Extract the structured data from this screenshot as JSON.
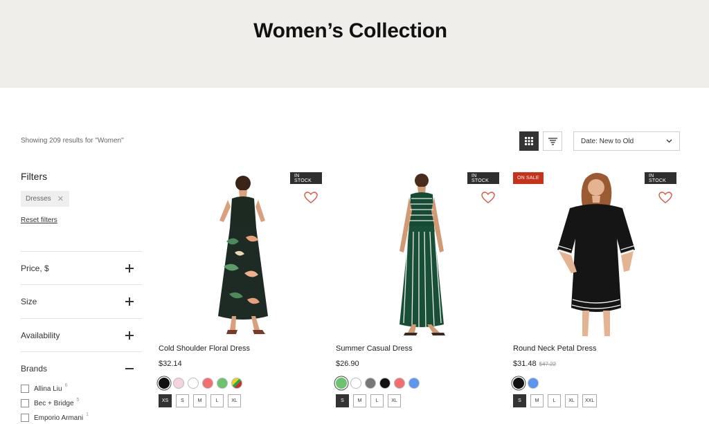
{
  "header": {
    "title": "Women’s Collection"
  },
  "toolbar": {
    "results_text": "Showing 209 results for \"Women\"",
    "grid_view_icon": "grid-icon",
    "list_view_icon": "filter-list-icon",
    "active_view": "grid",
    "sort_label": "Date: New to Old"
  },
  "sidebar": {
    "title": "Filters",
    "active_filter": "Dresses",
    "reset_label": "Reset filters",
    "sections": [
      {
        "label": "Price, $",
        "expanded": false
      },
      {
        "label": "Size",
        "expanded": false
      },
      {
        "label": "Availability",
        "expanded": false
      },
      {
        "label": "Brands",
        "expanded": true
      }
    ],
    "brands": [
      {
        "name": "Allina Liu",
        "count": "6"
      },
      {
        "name": "Bec + Bridge",
        "count": "5"
      },
      {
        "name": "Emporio Armani",
        "count": "1"
      }
    ]
  },
  "products": [
    {
      "name": "Cold Shoulder Floral Dress",
      "price": "$32.14",
      "old_price": "",
      "badge": "IN STOCK",
      "badge_type": "stock",
      "colors": [
        "#111111",
        "#f6d3dc",
        "#ffffff",
        "#f26f6f",
        "#6bc46d",
        "rainbow"
      ],
      "selected_color": 0,
      "sizes": [
        "XS",
        "S",
        "M",
        "L",
        "XL"
      ],
      "selected_size": 0
    },
    {
      "name": "Summer Casual Dress",
      "price": "$26.90",
      "old_price": "",
      "badge": "IN STOCK",
      "badge_type": "stock",
      "colors": [
        "#6bc46d",
        "#ffffff",
        "#777777",
        "#111111",
        "#f26f6f",
        "#5b97f0"
      ],
      "selected_color": 0,
      "sizes": [
        "S",
        "M",
        "L",
        "XL"
      ],
      "selected_size": 0
    },
    {
      "name": "Round Neck Petal Dress",
      "price": "$31.48",
      "old_price": "$47.22",
      "badge": "IN STOCK",
      "badge_type": "stock",
      "sale_badge": "ON SALE",
      "colors": [
        "#111111",
        "#5b97f0"
      ],
      "selected_color": 0,
      "sizes": [
        "S",
        "M",
        "L",
        "XL",
        "XXL"
      ],
      "selected_size": 0
    }
  ],
  "colors": {
    "accent_red": "#e0503f",
    "sale_red": "#c8321b",
    "dark": "#2f2f2f",
    "hero_bg": "#f0eeeb"
  }
}
